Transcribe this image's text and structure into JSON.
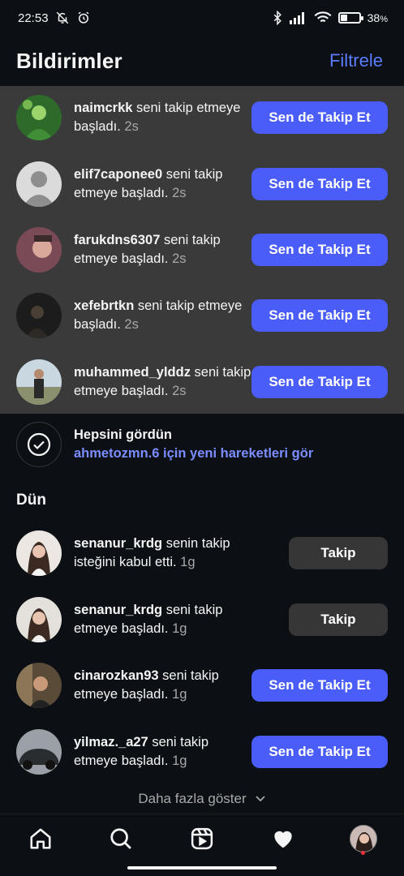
{
  "status_bar": {
    "time": "22:53",
    "battery": "38",
    "battery_unit": "%",
    "battery_level": 0.38
  },
  "header": {
    "title": "Bildirimler",
    "filter_label": "Filtrele"
  },
  "new_notifications": [
    {
      "username": "naimcrkk",
      "text_before": " seni takip ",
      "text_rest": "etmeye başladı.",
      "time": "2s",
      "button": "Sen de Takip Et",
      "avatar": "green"
    },
    {
      "username": "elif7caponee0",
      "text_before": " seni takip ",
      "text_rest": "etmeye başladı.",
      "time": "2s",
      "button": "Sen de Takip Et",
      "avatar": "default"
    },
    {
      "username": "farukdns6307",
      "text_before": " seni takip ",
      "text_rest": "etmeye başladı.",
      "time": "2s",
      "button": "Sen de Takip Et",
      "avatar": "pink"
    },
    {
      "username": "xefebrtkn",
      "text_before": " seni takip ",
      "text_rest": "etmeye başladı.",
      "time": "2s",
      "button": "Sen de Takip Et",
      "avatar": "dark"
    },
    {
      "username": "muhammed_ylddz",
      "text_before": " seni ",
      "text_rest": "takip etmeye başladı.",
      "time": "2s",
      "button": "Sen de Takip Et",
      "avatar": "sky"
    }
  ],
  "seen_all": {
    "title": "Hepsini gördün",
    "link": "ahmetozmn.6 için yeni hareketleri gör"
  },
  "section_yesterday": "Dün",
  "yesterday_notifications": [
    {
      "username": "senanur_krdg",
      "text_before": " senin takip ",
      "text_rest": "isteğini kabul etti.",
      "time": "1g",
      "button": "Takip",
      "style": "secondary",
      "avatar": "light"
    },
    {
      "username": "senanur_krdg",
      "text_before": " seni takip ",
      "text_rest": "etmeye başladı.",
      "time": "1g",
      "button": "Takip",
      "style": "secondary",
      "avatar": "light"
    },
    {
      "username": "cinarozkan93",
      "text_before": " seni takip ",
      "text_rest": "etmeye başladı.",
      "time": "1g",
      "button": "Sen de Takip Et",
      "style": "primary",
      "avatar": "brown"
    },
    {
      "username": "yilmaz._a27",
      "text_before": " seni takip ",
      "text_rest": "etmeye başladı.",
      "time": "1g",
      "button": "Sen de Takip Et",
      "style": "primary",
      "avatar": "car"
    }
  ],
  "show_more": "Daha fazla göster",
  "colors": {
    "accent": "#4a5df9",
    "link": "#7b8dff",
    "background": "#0c1014",
    "highlight": "#3a3a3a"
  },
  "nav": [
    "home-icon",
    "search-icon",
    "reels-icon",
    "heart-icon",
    "profile-avatar"
  ]
}
